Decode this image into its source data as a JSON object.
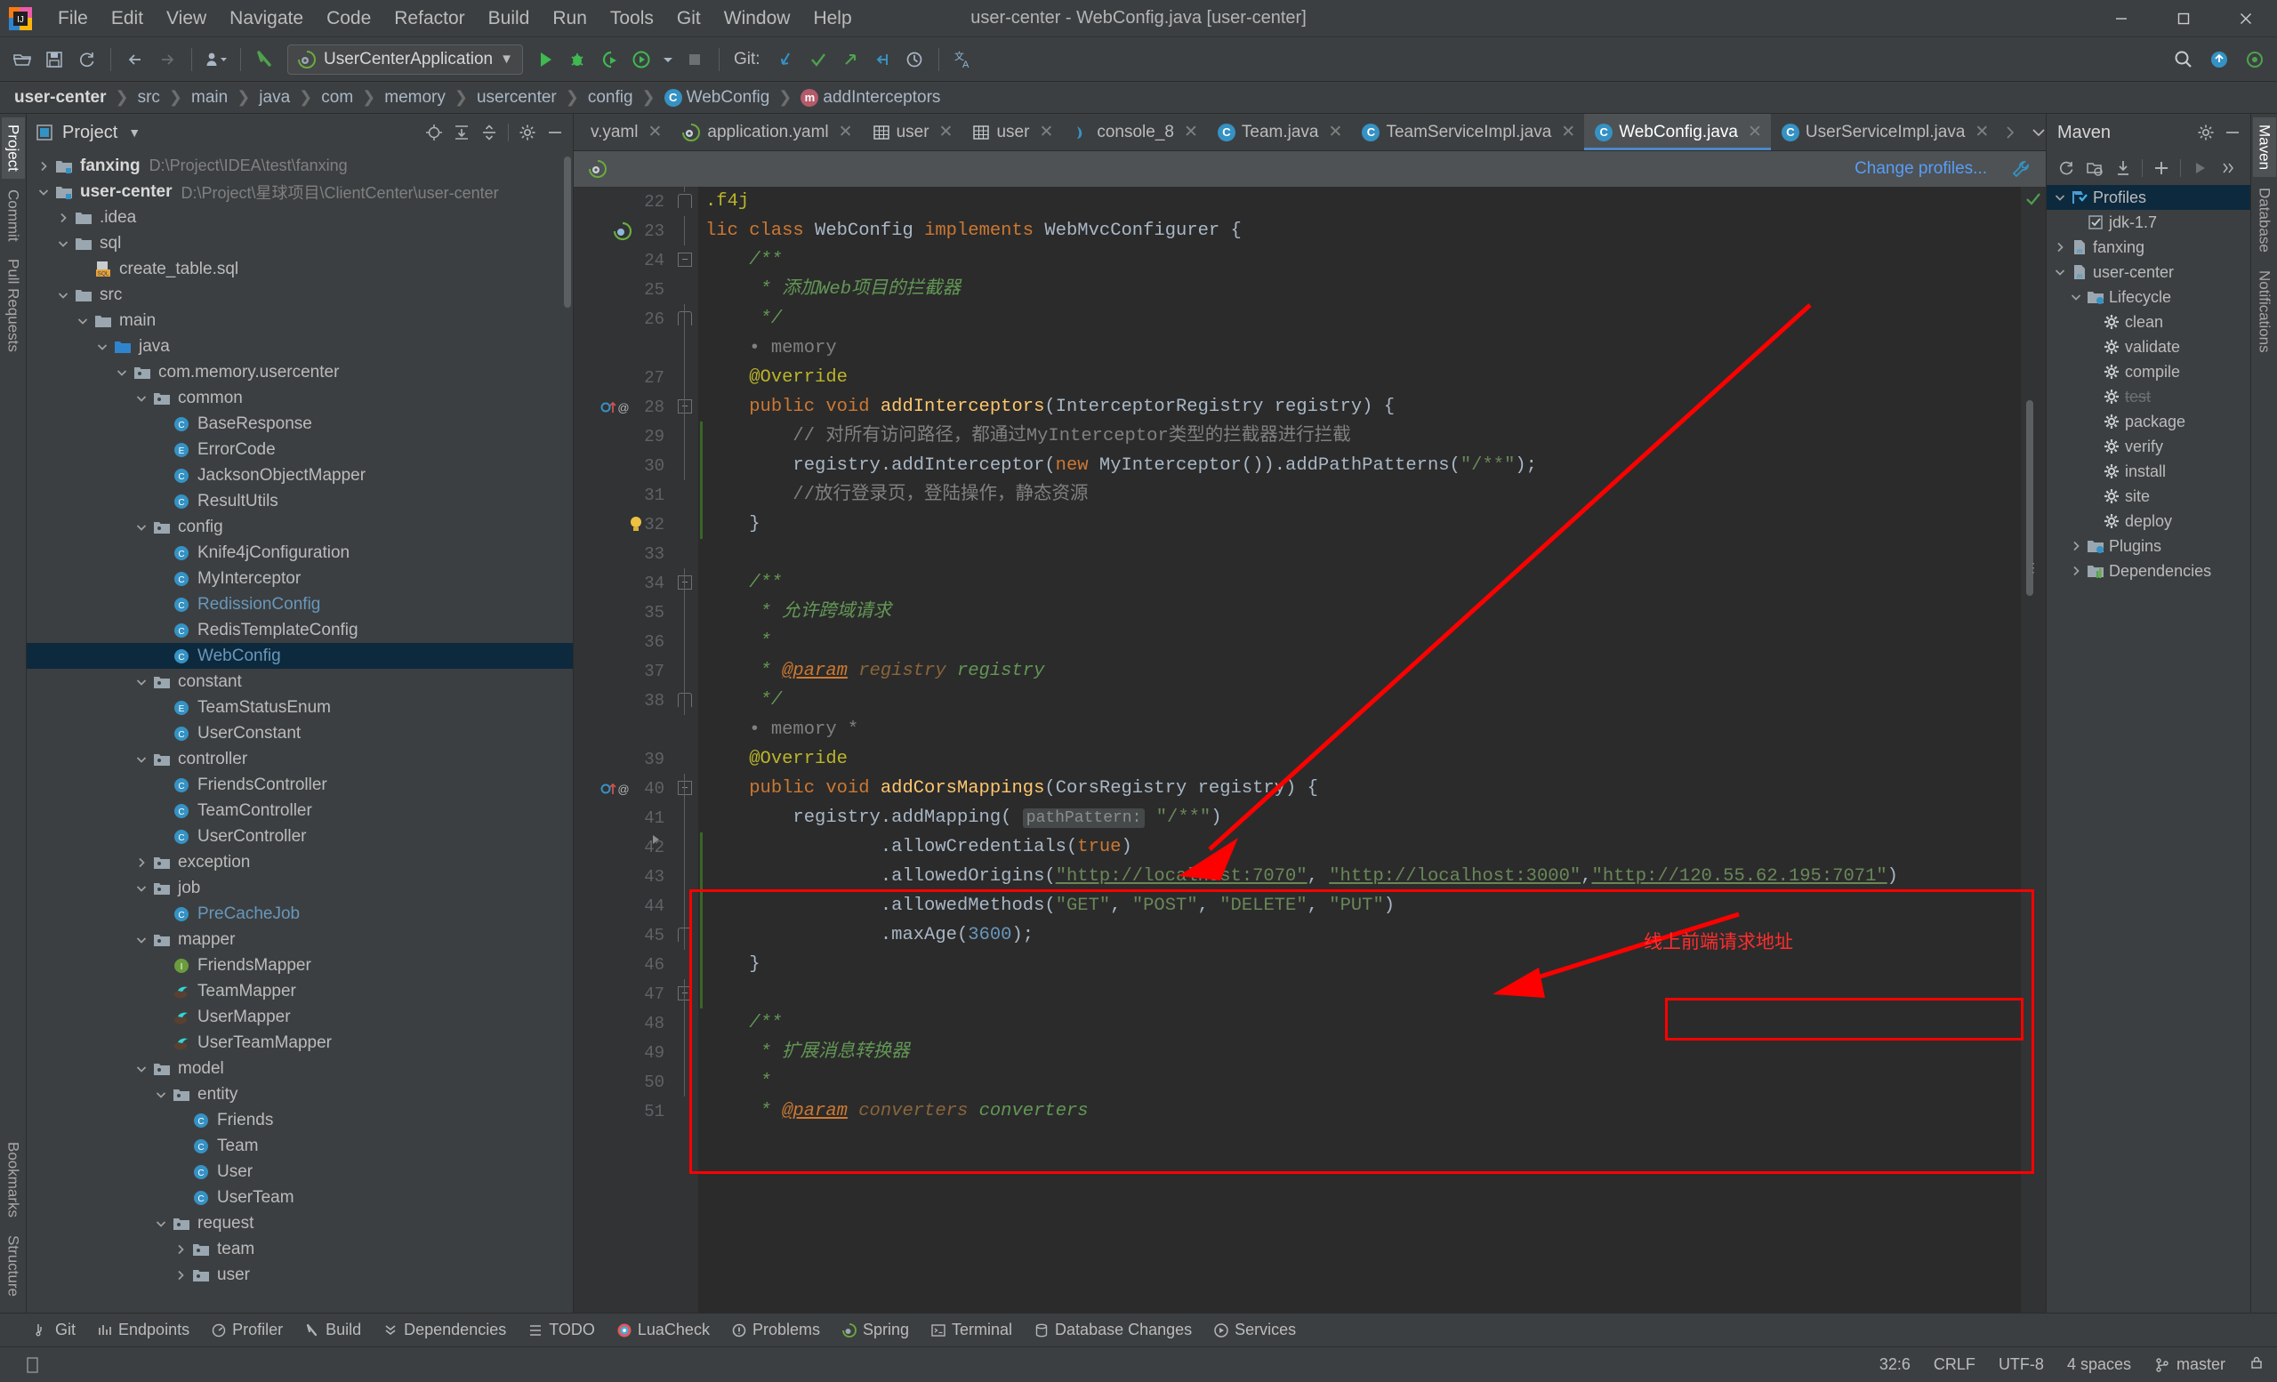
{
  "window": {
    "title": "user-center - WebConfig.java [user-center]",
    "controls": [
      "minimize",
      "maximize",
      "close"
    ]
  },
  "menu": [
    "File",
    "Edit",
    "View",
    "Navigate",
    "Code",
    "Refactor",
    "Build",
    "Run",
    "Tools",
    "Git",
    "Window",
    "Help"
  ],
  "toolbar": {
    "run_config": "UserCenterApplication",
    "git_label": "Git:",
    "icons": [
      "open-folder-icon",
      "save-icon",
      "sync-icon",
      "back-arrow-icon",
      "forward-arrow-icon",
      "user-dropdown-icon",
      "build-icon"
    ],
    "run_icons": [
      "run-icon",
      "debug-icon",
      "run-with-coverage-icon",
      "profile-icon",
      "dropdown-icon",
      "stop-icon"
    ],
    "git_icons": [
      "update-project-icon",
      "commit-icon",
      "push-icon",
      "rollback-icon",
      "history-icon"
    ],
    "right_icons": [
      "search-icon",
      "updates-icon",
      "settings-icon"
    ]
  },
  "breadcrumb": [
    {
      "label": "user-center",
      "bold": true,
      "icon": null
    },
    {
      "label": "src",
      "bold": false,
      "icon": null
    },
    {
      "label": "main",
      "bold": false,
      "icon": null
    },
    {
      "label": "java",
      "bold": false,
      "icon": null
    },
    {
      "label": "com",
      "bold": false,
      "icon": null
    },
    {
      "label": "memory",
      "bold": false,
      "icon": null
    },
    {
      "label": "usercenter",
      "bold": false,
      "icon": null
    },
    {
      "label": "config",
      "bold": false,
      "icon": null
    },
    {
      "label": "WebConfig",
      "bold": false,
      "icon": "class-badge"
    },
    {
      "label": "addInterceptors",
      "bold": false,
      "icon": "method-badge"
    }
  ],
  "left_rail": {
    "top": [
      "Project",
      "Commit",
      "Pull Requests"
    ],
    "bottom": [
      "Bookmarks",
      "Structure"
    ]
  },
  "right_rail": [
    "Maven",
    "Database",
    "Notifications"
  ],
  "project_panel": {
    "title": "Project",
    "header_icons": [
      "locate-icon",
      "expand-all-icon",
      "collapse-all-icon",
      "gear-icon",
      "hide-icon"
    ],
    "tree": [
      {
        "depth": 0,
        "arrow": "collapsed",
        "icon": "module-folder-icon",
        "label": "fanxing",
        "bold": true,
        "path": "D:\\Project\\IDEA\\test\\fanxing"
      },
      {
        "depth": 0,
        "arrow": "expanded",
        "icon": "module-folder-icon",
        "label": "user-center",
        "bold": true,
        "path": "D:\\Project\\星球项目\\ClientCenter\\user-center"
      },
      {
        "depth": 1,
        "arrow": "collapsed",
        "icon": "folder-icon",
        "label": ".idea"
      },
      {
        "depth": 1,
        "arrow": "expanded",
        "icon": "folder-icon",
        "label": "sql"
      },
      {
        "depth": 2,
        "arrow": "none",
        "icon": "sql-file-icon",
        "label": "create_table.sql"
      },
      {
        "depth": 1,
        "arrow": "expanded",
        "icon": "folder-icon",
        "label": "src"
      },
      {
        "depth": 2,
        "arrow": "expanded",
        "icon": "folder-icon",
        "label": "main"
      },
      {
        "depth": 3,
        "arrow": "expanded",
        "icon": "source-folder-icon",
        "label": "java"
      },
      {
        "depth": 4,
        "arrow": "expanded",
        "icon": "package-icon",
        "label": "com.memory.usercenter"
      },
      {
        "depth": 5,
        "arrow": "expanded",
        "icon": "package-icon",
        "label": "common"
      },
      {
        "depth": 6,
        "arrow": "none",
        "icon": "class-icon",
        "label": "BaseResponse"
      },
      {
        "depth": 6,
        "arrow": "none",
        "icon": "enum-icon",
        "label": "ErrorCode"
      },
      {
        "depth": 6,
        "arrow": "none",
        "icon": "class-icon",
        "label": "JacksonObjectMapper"
      },
      {
        "depth": 6,
        "arrow": "none",
        "icon": "class-icon",
        "label": "ResultUtils"
      },
      {
        "depth": 5,
        "arrow": "expanded",
        "icon": "package-icon",
        "label": "config"
      },
      {
        "depth": 6,
        "arrow": "none",
        "icon": "class-icon",
        "label": "Knife4jConfiguration"
      },
      {
        "depth": 6,
        "arrow": "none",
        "icon": "class-icon",
        "label": "MyInterceptor"
      },
      {
        "depth": 6,
        "arrow": "none",
        "icon": "class-icon",
        "label": "RedissionConfig",
        "blue": true
      },
      {
        "depth": 6,
        "arrow": "none",
        "icon": "class-icon",
        "label": "RedisTemplateConfig"
      },
      {
        "depth": 6,
        "arrow": "none",
        "icon": "class-icon",
        "label": "WebConfig",
        "blue": true,
        "selected": true
      },
      {
        "depth": 5,
        "arrow": "expanded",
        "icon": "package-icon",
        "label": "constant"
      },
      {
        "depth": 6,
        "arrow": "none",
        "icon": "enum-icon",
        "label": "TeamStatusEnum"
      },
      {
        "depth": 6,
        "arrow": "none",
        "icon": "class-icon",
        "label": "UserConstant"
      },
      {
        "depth": 5,
        "arrow": "expanded",
        "icon": "package-icon",
        "label": "controller"
      },
      {
        "depth": 6,
        "arrow": "none",
        "icon": "class-icon",
        "label": "FriendsController"
      },
      {
        "depth": 6,
        "arrow": "none",
        "icon": "class-icon",
        "label": "TeamController"
      },
      {
        "depth": 6,
        "arrow": "none",
        "icon": "class-icon",
        "label": "UserController"
      },
      {
        "depth": 5,
        "arrow": "collapsed",
        "icon": "package-icon",
        "label": "exception"
      },
      {
        "depth": 5,
        "arrow": "expanded",
        "icon": "package-icon",
        "label": "job"
      },
      {
        "depth": 6,
        "arrow": "none",
        "icon": "class-icon",
        "label": "PreCacheJob",
        "blue": true
      },
      {
        "depth": 5,
        "arrow": "expanded",
        "icon": "package-icon",
        "label": "mapper"
      },
      {
        "depth": 6,
        "arrow": "none",
        "icon": "interface-icon",
        "label": "FriendsMapper"
      },
      {
        "depth": 6,
        "arrow": "none",
        "icon": "mybatis-icon",
        "label": "TeamMapper"
      },
      {
        "depth": 6,
        "arrow": "none",
        "icon": "mybatis-icon",
        "label": "UserMapper"
      },
      {
        "depth": 6,
        "arrow": "none",
        "icon": "mybatis-icon",
        "label": "UserTeamMapper"
      },
      {
        "depth": 5,
        "arrow": "expanded",
        "icon": "package-icon",
        "label": "model"
      },
      {
        "depth": 6,
        "arrow": "expanded",
        "icon": "package-icon",
        "label": "entity"
      },
      {
        "depth": 7,
        "arrow": "none",
        "icon": "class-icon",
        "label": "Friends"
      },
      {
        "depth": 7,
        "arrow": "none",
        "icon": "class-icon",
        "label": "Team"
      },
      {
        "depth": 7,
        "arrow": "none",
        "icon": "class-icon",
        "label": "User"
      },
      {
        "depth": 7,
        "arrow": "none",
        "icon": "class-icon",
        "label": "UserTeam"
      },
      {
        "depth": 6,
        "arrow": "expanded",
        "icon": "package-icon",
        "label": "request"
      },
      {
        "depth": 7,
        "arrow": "collapsed",
        "icon": "package-icon",
        "label": "team"
      },
      {
        "depth": 7,
        "arrow": "collapsed",
        "icon": "package-icon",
        "label": "user"
      }
    ]
  },
  "editor_tabs": [
    {
      "label": "v.yaml",
      "icon": "yaml-icon",
      "active": false,
      "truncated": true
    },
    {
      "label": "application.yaml",
      "icon": "spring-yaml-icon",
      "active": false
    },
    {
      "label": "user",
      "icon": "table-icon",
      "active": false
    },
    {
      "label": "user",
      "icon": "table-icon",
      "active": false
    },
    {
      "label": "console_8",
      "icon": "console-icon",
      "active": false
    },
    {
      "label": "Team.java",
      "icon": "class-badge",
      "active": false
    },
    {
      "label": "TeamServiceImpl.java",
      "icon": "class-badge",
      "active": false
    },
    {
      "label": "WebConfig.java",
      "icon": "class-badge",
      "active": true
    },
    {
      "label": "UserServiceImpl.java",
      "icon": "class-badge",
      "active": false
    }
  ],
  "editor_banner": {
    "icon": "spring-icon",
    "link": "Change profiles...",
    "wrench": "wrench-icon"
  },
  "code": {
    "first_line": 22,
    "lines": [
      {
        "n": 22,
        "html": "<span class=\"anno\">.f4j</span>"
      },
      {
        "n": 23,
        "html": "<span class=\"kw\">lic class </span><span class=\"cls\">WebConfig </span><span class=\"kw\">implements </span><span class=\"cls\">WebMvcConfigurer </span><span class=\"id\">{</span>"
      },
      {
        "n": 24,
        "html": "    <span class=\"doc\">/**</span>"
      },
      {
        "n": 25,
        "html": "     <span class=\"doc\">* 添加Web项目的拦截器</span>"
      },
      {
        "n": 26,
        "html": "     <span class=\"doc\">*/</span>"
      },
      {
        "n": "",
        "html": "    <span class=\"cmt\">• memory</span>"
      },
      {
        "n": 27,
        "html": "    <span class=\"anno\">@Override</span>"
      },
      {
        "n": 28,
        "html": "    <span class=\"kw\">public void </span><span class=\"fn\">addInterceptors</span><span class=\"id\">(</span><span class=\"cls\">InterceptorRegistry </span><span class=\"id\">registry) {</span>"
      },
      {
        "n": 29,
        "html": "        <span class=\"cmt\">// 对所有访问路径，都通过MyInterceptor类型的拦截器进行拦截</span>"
      },
      {
        "n": 30,
        "html": "        <span class=\"id\">registry.addInterceptor(</span><span class=\"kw\">new </span><span class=\"id\">MyInterceptor()).addPathPatterns(</span><span class=\"str\">\"/**\"</span><span class=\"id\">);</span>"
      },
      {
        "n": 31,
        "html": "        <span class=\"cmt\">//放行登录页，登陆操作，静态资源</span>"
      },
      {
        "n": 32,
        "html": "    <span class=\"id\">}</span>"
      },
      {
        "n": 33,
        "html": ""
      },
      {
        "n": 34,
        "html": "    <span class=\"doc\">/**</span>"
      },
      {
        "n": 35,
        "html": "     <span class=\"doc\">* 允许跨域请求</span>"
      },
      {
        "n": 36,
        "html": "     <span class=\"doc\">*</span>"
      },
      {
        "n": 37,
        "html": "     <span class=\"doc\">* <span style=\"color:#cc7832;text-decoration:underline\">@param</span> <span style=\"color:#8a653b\">registry</span> registry</span>"
      },
      {
        "n": 38,
        "html": "     <span class=\"doc\">*/</span>"
      },
      {
        "n": "",
        "html": "    <span class=\"cmt\">• memory *</span>"
      },
      {
        "n": 39,
        "html": "    <span class=\"anno\">@Override</span>"
      },
      {
        "n": 40,
        "html": "    <span class=\"kw\">public void </span><span class=\"fn\">addCorsMappings</span><span class=\"id\">(</span><span class=\"cls\">CorsRegistry </span><span class=\"id\">registry) {</span>"
      },
      {
        "n": 41,
        "html": "        <span class=\"id\">registry.addMapping(</span> <span class=\"hint\">pathPattern:</span> <span class=\"str\">\"/**\"</span><span class=\"id\">)</span>"
      },
      {
        "n": 42,
        "html": "                <span class=\"id\">.allowCredentials(</span><span class=\"kw\">true</span><span class=\"id\">)</span>"
      },
      {
        "n": 43,
        "html": "                <span class=\"id\">.allowedOrigins(</span><span class=\"link\">\"http://localhost:7070\"</span><span class=\"id\">, </span><span class=\"link\">\"http://localhost:3000\"</span><span class=\"id\">,</span><span class=\"link\">\"http://120.55.62.195:7071\"</span><span class=\"id\">)</span>"
      },
      {
        "n": 44,
        "html": "                <span class=\"id\">.allowedMethods(</span><span class=\"str\">\"GET\"</span><span class=\"id\">, </span><span class=\"str\">\"POST\"</span><span class=\"id\">, </span><span class=\"str\">\"DELETE\"</span><span class=\"id\">, </span><span class=\"str\">\"PUT\"</span><span class=\"id\">)</span>"
      },
      {
        "n": 45,
        "html": "                <span class=\"id\">.maxAge(</span><span class=\"num\">3600</span><span class=\"id\">);</span>"
      },
      {
        "n": 46,
        "html": "    <span class=\"id\">}</span>"
      },
      {
        "n": 47,
        "html": ""
      },
      {
        "n": 48,
        "html": "    <span class=\"doc\">/**</span>"
      },
      {
        "n": 49,
        "html": "     <span class=\"doc\">* 扩展消息转换器</span>"
      },
      {
        "n": 50,
        "html": "     <span class=\"doc\">*</span>"
      },
      {
        "n": 51,
        "html": "     <span class=\"doc\">* <span style=\"color:#cc7832;text-decoration:underline\">@param</span> <span style=\"color:#8a653b\">converters</span> converters</span>"
      }
    ]
  },
  "annotations": {
    "label": "线上前端请求地址",
    "color": "#ff0000"
  },
  "maven_panel": {
    "title": "Maven",
    "head_icons": [
      "gear-icon",
      "hide-icon"
    ],
    "toolbar_icons": [
      "reload-icon",
      "add-module-icon",
      "download-sources-icon",
      "plus-icon",
      "run-icon",
      "more-icon"
    ],
    "tree": [
      {
        "depth": 0,
        "arrow": "expanded",
        "icon": "profiles-icon",
        "label": "Profiles",
        "selected": true
      },
      {
        "depth": 1,
        "arrow": "none",
        "icon": "checkbox-checked",
        "label": "jdk-1.7"
      },
      {
        "depth": 0,
        "arrow": "collapsed",
        "icon": "maven-module-icon",
        "label": "fanxing"
      },
      {
        "depth": 0,
        "arrow": "expanded",
        "icon": "maven-module-icon",
        "label": "user-center"
      },
      {
        "depth": 1,
        "arrow": "expanded",
        "icon": "lifecycle-icon",
        "label": "Lifecycle"
      },
      {
        "depth": 2,
        "arrow": "none",
        "icon": "goal-icon",
        "label": "clean"
      },
      {
        "depth": 2,
        "arrow": "none",
        "icon": "goal-icon",
        "label": "validate"
      },
      {
        "depth": 2,
        "arrow": "none",
        "icon": "goal-icon",
        "label": "compile"
      },
      {
        "depth": 2,
        "arrow": "none",
        "icon": "goal-icon",
        "label": "test",
        "disabled": true
      },
      {
        "depth": 2,
        "arrow": "none",
        "icon": "goal-icon",
        "label": "package"
      },
      {
        "depth": 2,
        "arrow": "none",
        "icon": "goal-icon",
        "label": "verify"
      },
      {
        "depth": 2,
        "arrow": "none",
        "icon": "goal-icon",
        "label": "install"
      },
      {
        "depth": 2,
        "arrow": "none",
        "icon": "goal-icon",
        "label": "site"
      },
      {
        "depth": 2,
        "arrow": "none",
        "icon": "goal-icon",
        "label": "deploy"
      },
      {
        "depth": 1,
        "arrow": "collapsed",
        "icon": "plugins-icon",
        "label": "Plugins"
      },
      {
        "depth": 1,
        "arrow": "collapsed",
        "icon": "dependencies-icon",
        "label": "Dependencies"
      }
    ]
  },
  "tool_windows": [
    {
      "label": "Git",
      "icon": "git-icon"
    },
    {
      "label": "Endpoints",
      "icon": "endpoints-icon"
    },
    {
      "label": "Profiler",
      "icon": "profiler-icon"
    },
    {
      "label": "Build",
      "icon": "build-icon"
    },
    {
      "label": "Dependencies",
      "icon": "dependencies-icon"
    },
    {
      "label": "TODO",
      "icon": "todo-icon"
    },
    {
      "label": "LuaCheck",
      "icon": "luacheck-icon"
    },
    {
      "label": "Problems",
      "icon": "problems-icon"
    },
    {
      "label": "Spring",
      "icon": "spring-icon"
    },
    {
      "label": "Terminal",
      "icon": "terminal-icon"
    },
    {
      "label": "Database Changes",
      "icon": "database-changes-icon"
    },
    {
      "label": "Services",
      "icon": "services-icon"
    }
  ],
  "statusbar": {
    "caret": "32:6",
    "line_separator": "CRLF",
    "encoding": "UTF-8",
    "indent": "4 spaces",
    "branch": "master",
    "branch_icon": "branch-icon",
    "lock_icon": "lock-icon"
  }
}
